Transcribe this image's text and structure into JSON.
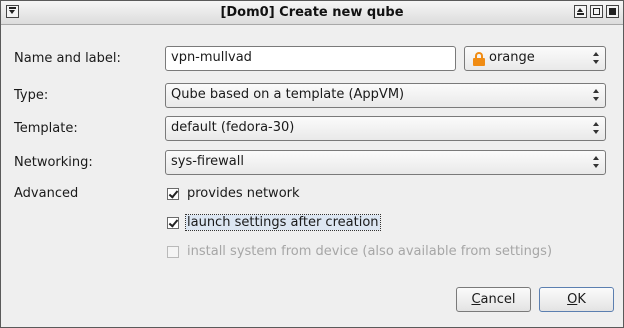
{
  "window": {
    "title": "[Dom0] Create new qube"
  },
  "form": {
    "name_label": "Name and label:",
    "name_value": "vpn-mullvad",
    "color_value": "orange",
    "type_label": "Type:",
    "type_value": "Qube based on a template (AppVM)",
    "template_label": "Template:",
    "template_value": "default (fedora-30)",
    "networking_label": "Networking:",
    "networking_value": "sys-firewall",
    "advanced_label": "Advanced",
    "options": [
      {
        "label": "provides network",
        "checked": true,
        "enabled": true
      },
      {
        "label": "launch settings after creation",
        "checked": true,
        "enabled": true
      },
      {
        "label": "install system from device (also available from settings)",
        "checked": false,
        "enabled": false
      }
    ]
  },
  "buttons": {
    "cancel_prefix": "",
    "cancel_mnemonic": "C",
    "cancel_rest": "ancel",
    "ok_prefix": "",
    "ok_mnemonic": "O",
    "ok_rest": "K"
  },
  "colors": {
    "lock_accent": "#f08c14"
  }
}
